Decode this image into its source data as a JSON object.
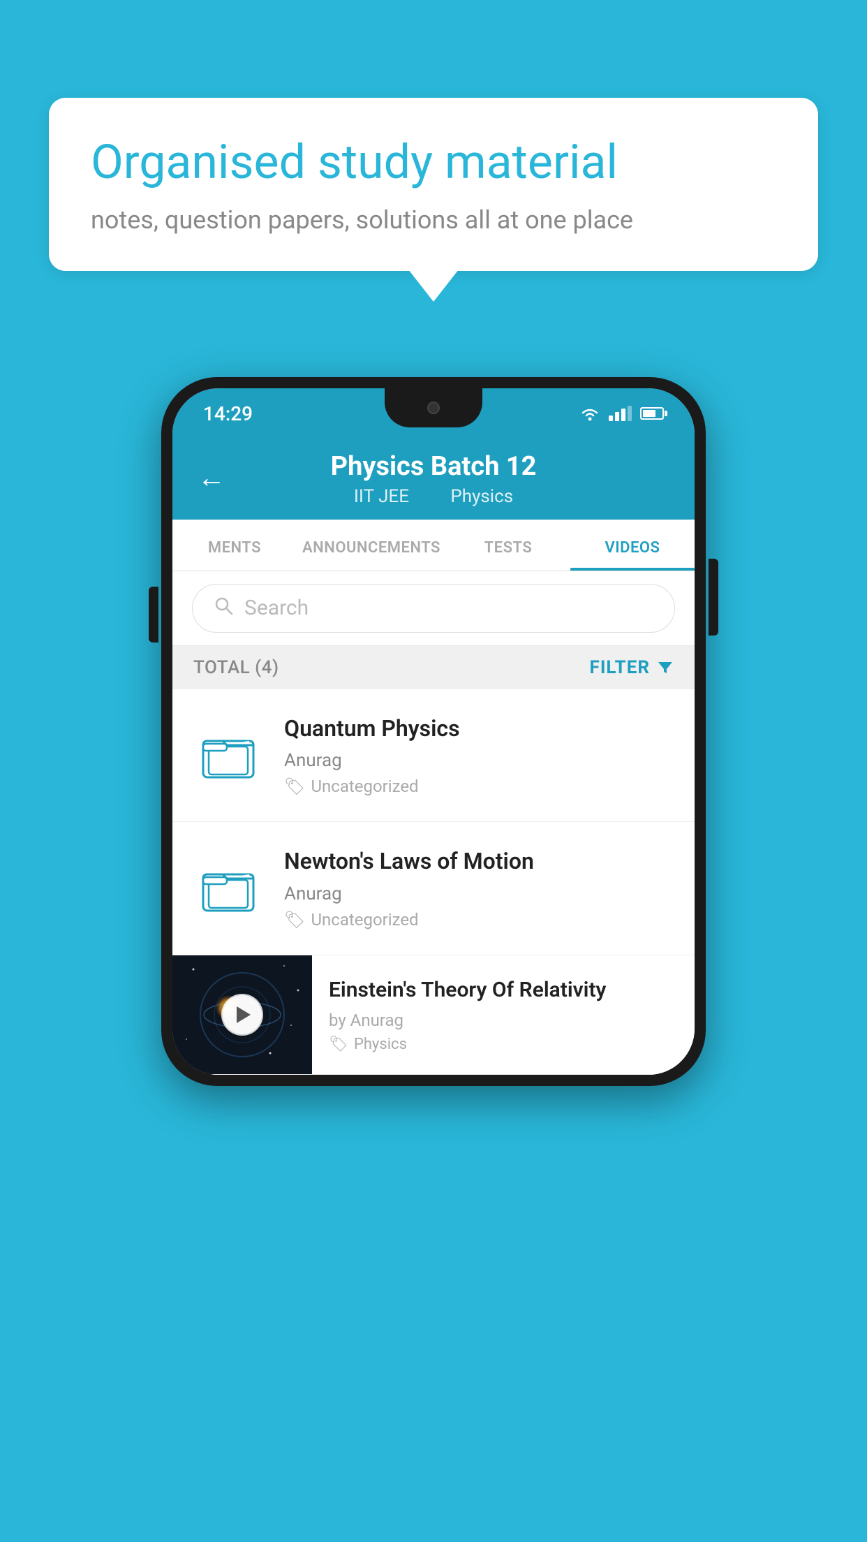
{
  "background_color": "#29b6d8",
  "speech_bubble": {
    "heading": "Organised study material",
    "subtext": "notes, question papers, solutions all at one place"
  },
  "status_bar": {
    "time": "14:29",
    "wifi": true,
    "signal": true,
    "battery": true
  },
  "app_header": {
    "back_label": "←",
    "title": "Physics Batch 12",
    "subtitle_part1": "IIT JEE",
    "subtitle_part2": "Physics"
  },
  "tabs": [
    {
      "label": "MENTS",
      "active": false
    },
    {
      "label": "ANNOUNCEMENTS",
      "active": false
    },
    {
      "label": "TESTS",
      "active": false
    },
    {
      "label": "VIDEOS",
      "active": true
    }
  ],
  "search": {
    "placeholder": "Search"
  },
  "filter_bar": {
    "total_label": "TOTAL (4)",
    "filter_label": "FILTER"
  },
  "videos": [
    {
      "id": 1,
      "title": "Quantum Physics",
      "author": "Anurag",
      "tag": "Uncategorized",
      "has_thumbnail": false
    },
    {
      "id": 2,
      "title": "Newton's Laws of Motion",
      "author": "Anurag",
      "tag": "Uncategorized",
      "has_thumbnail": false
    },
    {
      "id": 3,
      "title": "Einstein's Theory Of Relativity",
      "author": "by Anurag",
      "tag": "Physics",
      "has_thumbnail": true
    }
  ],
  "icons": {
    "back": "←",
    "search": "🔍",
    "folder": "folder-icon",
    "tag": "🏷",
    "filter_funnel": "▼",
    "play": "▶"
  }
}
